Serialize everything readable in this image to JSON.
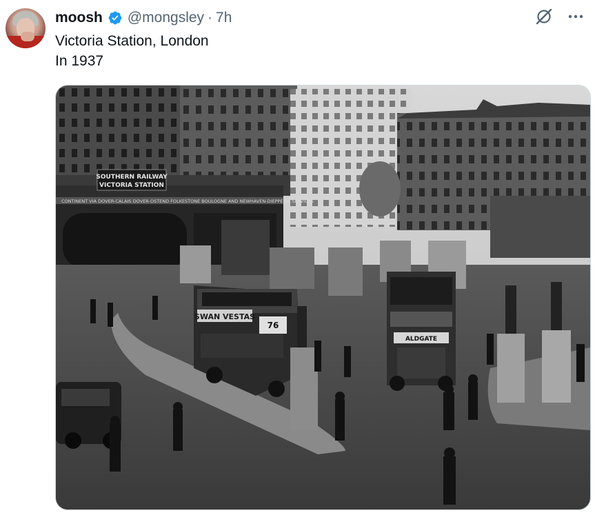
{
  "author": {
    "display_name": "moosh",
    "handle": "@mongsley",
    "separator": "·",
    "timestamp": "7h",
    "verified_color": "#1d9bf0"
  },
  "tweet": {
    "line1": "Victoria Station, London",
    "line2": "In 1937"
  },
  "media": {
    "sign_line1": "SOUTHERN RAILWAY",
    "sign_line2": "VICTORIA STATION",
    "banner": "CONTINENT VIA DOVER-CALAIS DOVER-OSTEND FOLKESTONE  BOULOGNE AND NEWHAVEN-DIEPPE RE SERVICES",
    "bus_ad": "SWAN VESTAS",
    "bus_route": "76",
    "bus_dest": "ALDGATE",
    "icons": [
      "grok-icon",
      "more-icon",
      "verified-icon"
    ]
  }
}
